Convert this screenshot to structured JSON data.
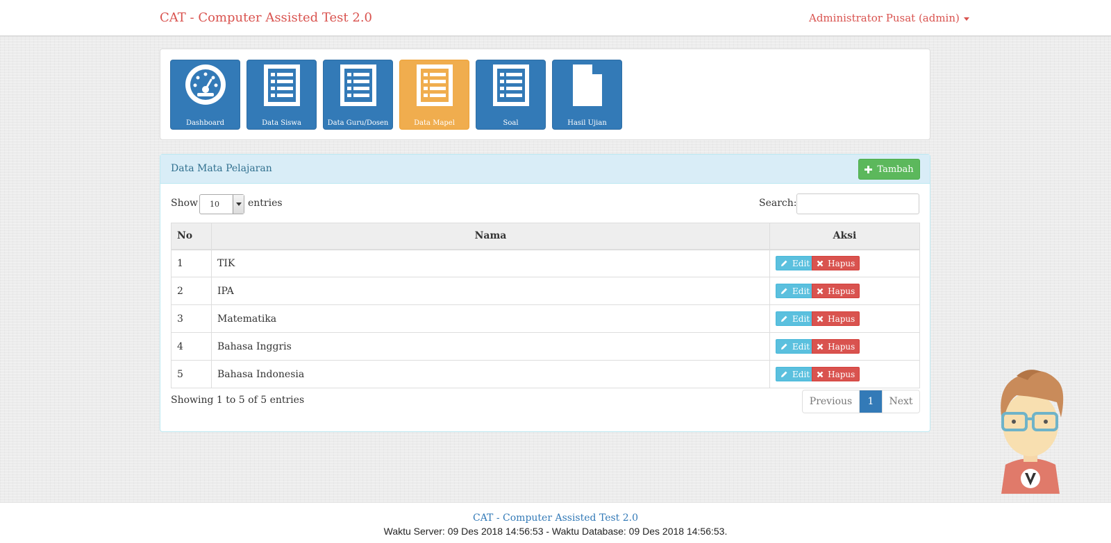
{
  "app": {
    "brand": "CAT - Computer Assisted Test 2.0",
    "user": "Administrator Pusat (admin)"
  },
  "menu": {
    "tiles": [
      {
        "label": "Dashboard",
        "icon": "dashboard-icon",
        "active": false
      },
      {
        "label": "Data Siswa",
        "icon": "list-icon",
        "active": false
      },
      {
        "label": "Data Guru/Dosen",
        "icon": "list-icon",
        "active": false
      },
      {
        "label": "Data Mapel",
        "icon": "list-icon",
        "active": true
      },
      {
        "label": "Soal",
        "icon": "list-icon",
        "active": false
      },
      {
        "label": "Hasil Ujian",
        "icon": "file-icon",
        "active": false
      }
    ]
  },
  "panel": {
    "title": "Data Mata Pelajaran",
    "add_label": "Tambah"
  },
  "controls": {
    "show_label": "Show",
    "entries_value": "10",
    "entries_label": "entries",
    "search_label": "Search:",
    "search_value": ""
  },
  "table": {
    "columns": [
      "No",
      "Nama",
      "Aksi"
    ],
    "rows": [
      {
        "no": "1",
        "nama": "TIK"
      },
      {
        "no": "2",
        "nama": "IPA"
      },
      {
        "no": "3",
        "nama": "Matematika"
      },
      {
        "no": "4",
        "nama": "Bahasa Inggris"
      },
      {
        "no": "5",
        "nama": "Bahasa Indonesia"
      }
    ],
    "edit_label": "Edit",
    "delete_label": "Hapus"
  },
  "pagination": {
    "info": "Showing 1 to 5 of 5 entries",
    "previous": "Previous",
    "current": "1",
    "next": "Next"
  },
  "footer": {
    "line1": "CAT - Computer Assisted Test 2.0",
    "line2": "Waktu Server: 09 Des 2018 14:56:53 - Waktu Database: 09 Des 2018 14:56:53."
  },
  "colors": {
    "primary": "#337ab7",
    "active_tile": "#f0ad4e",
    "danger": "#d9534f",
    "success": "#5cb85c",
    "info": "#5bc0de",
    "panel_heading": "#d9edf7"
  }
}
